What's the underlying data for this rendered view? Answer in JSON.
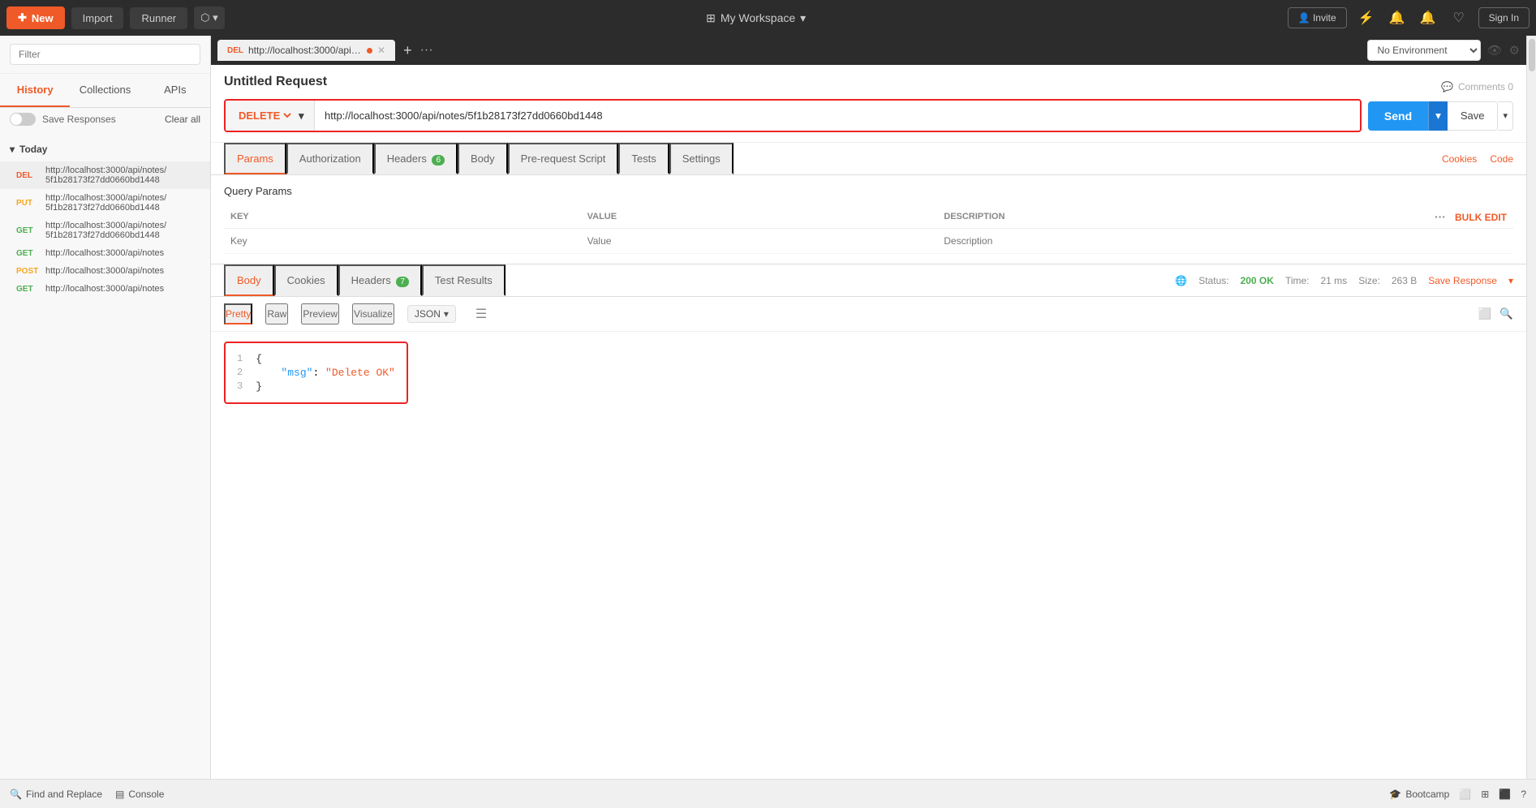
{
  "topbar": {
    "new_label": "New",
    "import_label": "Import",
    "runner_label": "Runner",
    "workspace_label": "My Workspace",
    "invite_label": "Invite",
    "sign_in_label": "Sign In"
  },
  "sidebar": {
    "filter_placeholder": "Filter",
    "tabs": [
      "History",
      "Collections",
      "APIs"
    ],
    "active_tab": "History",
    "save_responses_label": "Save Responses",
    "clear_all_label": "Clear all",
    "today_label": "Today",
    "history_items": [
      {
        "method": "DEL",
        "url_line1": "http://localhost:3000/api/notes/",
        "url_line2": "5f1b28173f27dd0660bd1448",
        "type": "del"
      },
      {
        "method": "PUT",
        "url_line1": "http://localhost:3000/api/notes/",
        "url_line2": "5f1b28173f27dd0660bd1448",
        "type": "put"
      },
      {
        "method": "GET",
        "url_line1": "http://localhost:3000/api/notes/",
        "url_line2": "5f1b28173f27dd0660bd1448",
        "type": "get"
      },
      {
        "method": "GET",
        "url": "http://localhost:3000/api/notes",
        "type": "get"
      },
      {
        "method": "POST",
        "url": "http://localhost:3000/api/notes",
        "type": "post"
      },
      {
        "method": "GET",
        "url": "http://localhost:3000/api/notes",
        "type": "get"
      }
    ]
  },
  "request": {
    "tab_method": "DEL",
    "tab_url": "http://localhost:3000/api/notes...",
    "title": "Untitled Request",
    "comments_label": "Comments 0",
    "method": "DELETE",
    "url": "http://localhost:3000/api/notes/5f1b28173f27dd0660bd1448",
    "send_label": "Send",
    "save_label": "Save",
    "tabs": [
      "Params",
      "Authorization",
      "Headers (6)",
      "Body",
      "Pre-request Script",
      "Tests",
      "Settings"
    ],
    "active_tab": "Params",
    "query_params_label": "Query Params",
    "params_key_header": "KEY",
    "params_value_header": "VALUE",
    "params_description_header": "DESCRIPTION",
    "params_key_placeholder": "Key",
    "params_value_placeholder": "Value",
    "params_description_placeholder": "Description",
    "bulk_edit_label": "Bulk Edit",
    "cookies_label": "Cookies",
    "code_label": "Code"
  },
  "response": {
    "tabs": [
      "Body",
      "Cookies",
      "Headers (7)",
      "Test Results"
    ],
    "active_tab": "Body",
    "status_label": "Status:",
    "status_value": "200 OK",
    "time_label": "Time:",
    "time_value": "21 ms",
    "size_label": "Size:",
    "size_value": "263 B",
    "save_response_label": "Save Response",
    "body_tabs": [
      "Pretty",
      "Raw",
      "Preview",
      "Visualize"
    ],
    "active_body_tab": "Pretty",
    "format": "JSON",
    "json_lines": [
      {
        "num": "1",
        "content": "{"
      },
      {
        "num": "2",
        "content": "    \"msg\": \"Delete OK\""
      },
      {
        "num": "3",
        "content": "}"
      }
    ]
  },
  "env": {
    "label": "No Environment"
  },
  "bottombar": {
    "find_replace_label": "Find and Replace",
    "console_label": "Console",
    "bootcamp_label": "Bootcamp"
  }
}
